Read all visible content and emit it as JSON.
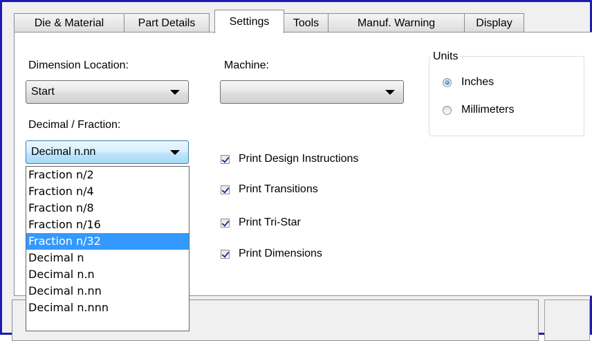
{
  "tabs": [
    {
      "label": "Die & Material",
      "active": false
    },
    {
      "label": "Part Details",
      "active": false
    },
    {
      "label": "Settings",
      "active": true
    },
    {
      "label": "Tools",
      "active": false
    },
    {
      "label": "Manuf. Warning",
      "active": false
    },
    {
      "label": "Display",
      "active": false
    }
  ],
  "dimension_location": {
    "label": "Dimension Location:",
    "value": "Start"
  },
  "machine": {
    "label": "Machine:",
    "value": ""
  },
  "decimal_fraction": {
    "label": "Decimal / Fraction:",
    "value": "Decimal n.nn",
    "options": [
      "Fraction n/2",
      "Fraction n/4",
      "Fraction n/8",
      "Fraction n/16",
      "Fraction n/32",
      "Decimal n",
      "Decimal n.n",
      "Decimal n.nn",
      "Decimal n.nnn"
    ],
    "highlighted": "Fraction n/32"
  },
  "print_options": [
    {
      "label": "Print Design Instructions",
      "checked": true
    },
    {
      "label": "Print Transitions",
      "checked": true
    },
    {
      "label": "Print Tri-Star",
      "checked": true
    },
    {
      "label": "Print Dimensions",
      "checked": true
    }
  ],
  "units": {
    "title": "Units",
    "options": [
      {
        "label": "Inches",
        "selected": true
      },
      {
        "label": "Millimeters",
        "selected": false
      }
    ]
  },
  "colors": {
    "highlight": "#3399ff",
    "window_border": "#1c1cb4",
    "panel_background": "#ffffff"
  }
}
